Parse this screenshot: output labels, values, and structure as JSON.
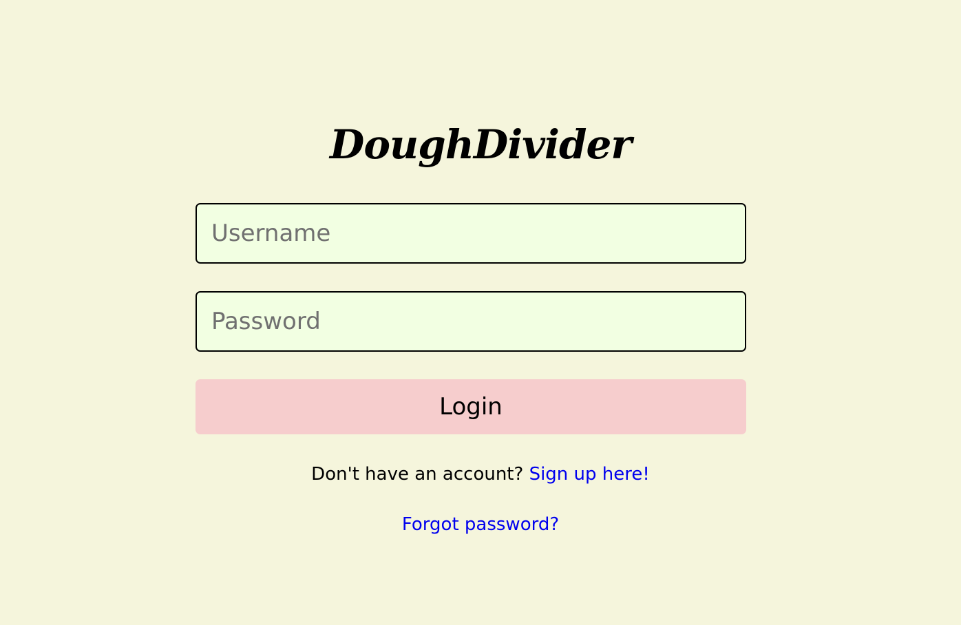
{
  "app": {
    "title": "DoughDivider"
  },
  "form": {
    "username_placeholder": "Username",
    "username_value": "",
    "password_placeholder": "Password",
    "password_value": "",
    "login_label": "Login"
  },
  "footer": {
    "signup_prompt": "Don't have an account?",
    "signup_link": "Sign up here!",
    "forgot_link": "Forgot password?"
  },
  "colors": {
    "background": "#f5f5dc",
    "input_background": "#f2ffe2",
    "button_background": "#f6cdcd",
    "link": "#0000ee"
  }
}
